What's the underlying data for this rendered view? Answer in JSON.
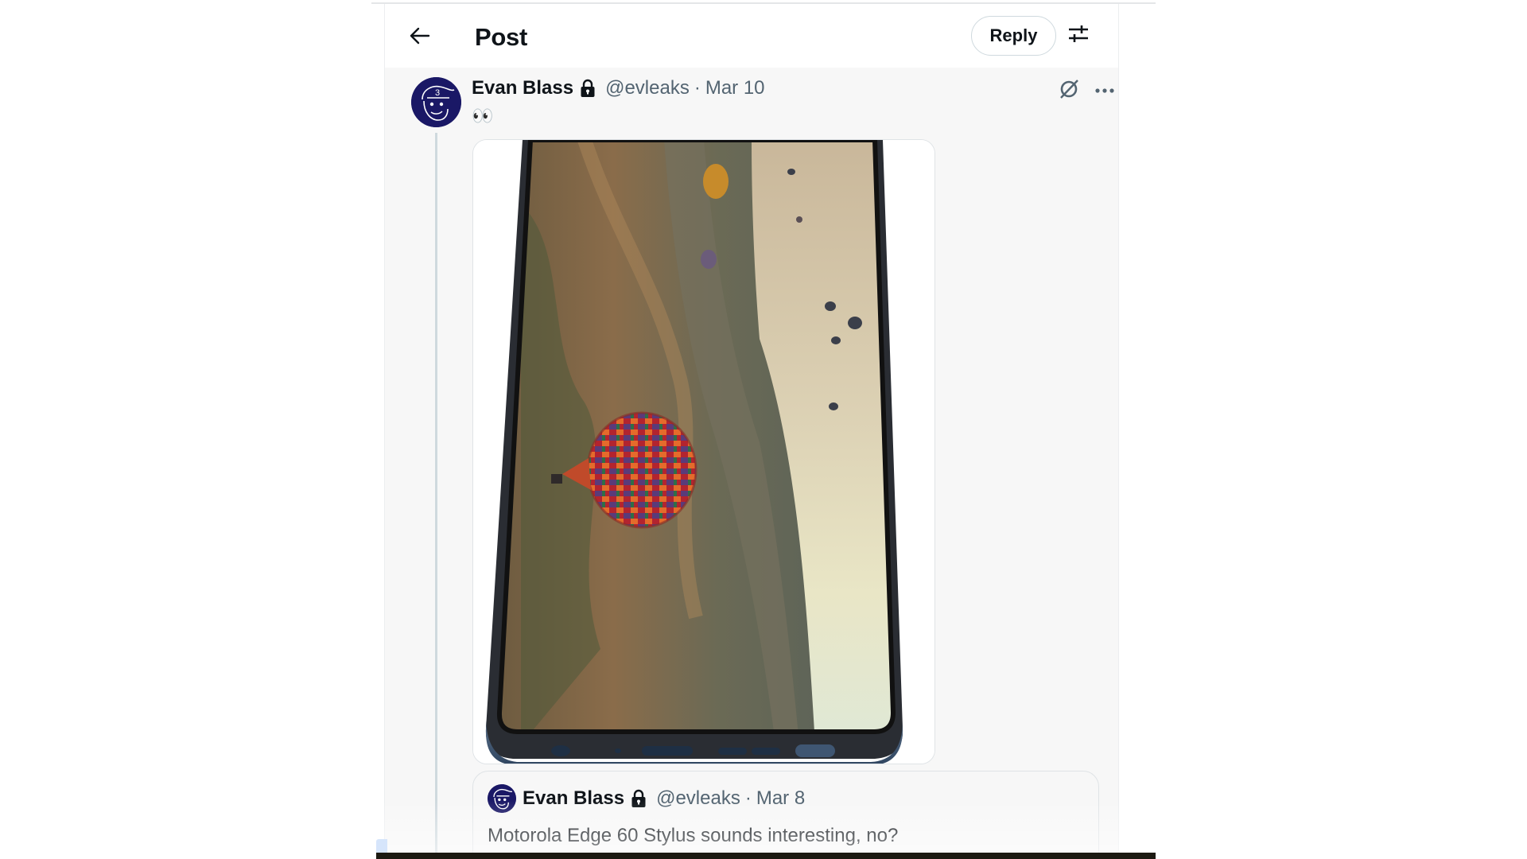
{
  "header": {
    "title": "Post",
    "back_icon": "arrow-left-icon",
    "reply_label": "Reply",
    "settings_icon": "sliders-icon"
  },
  "post": {
    "author_name": "Evan Blass",
    "protected_icon": "lock-icon",
    "handle": "@evleaks",
    "separator": "·",
    "date": "Mar 10",
    "text": "👀",
    "grok_icon": "grok-icon",
    "more_icon": "more-horizontal-icon",
    "media": {
      "kind": "image",
      "description": "Motorola phone rendered in landscape showing hot air balloons over Cappadocia"
    }
  },
  "quoted_post": {
    "author_name": "Evan Blass",
    "protected_icon": "lock-icon",
    "handle": "@evleaks",
    "separator": "·",
    "date": "Mar 8",
    "text": "Motorola Edge 60 Stylus sounds interesting, no?"
  },
  "colors": {
    "text_primary": "#0f1419",
    "text_secondary": "#536471",
    "border": "#cfd9de",
    "avatar_bg": "#1a1866"
  }
}
